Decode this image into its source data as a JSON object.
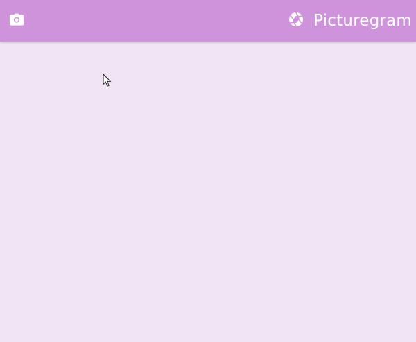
{
  "app": {
    "title": "Picturegram"
  },
  "toolbar": {
    "left_icon": "camera-icon",
    "brand_icon": "aperture-icon"
  },
  "colors": {
    "appbar": "#cf93dc",
    "background": "#f1e4f4",
    "text": "#ffffff"
  }
}
